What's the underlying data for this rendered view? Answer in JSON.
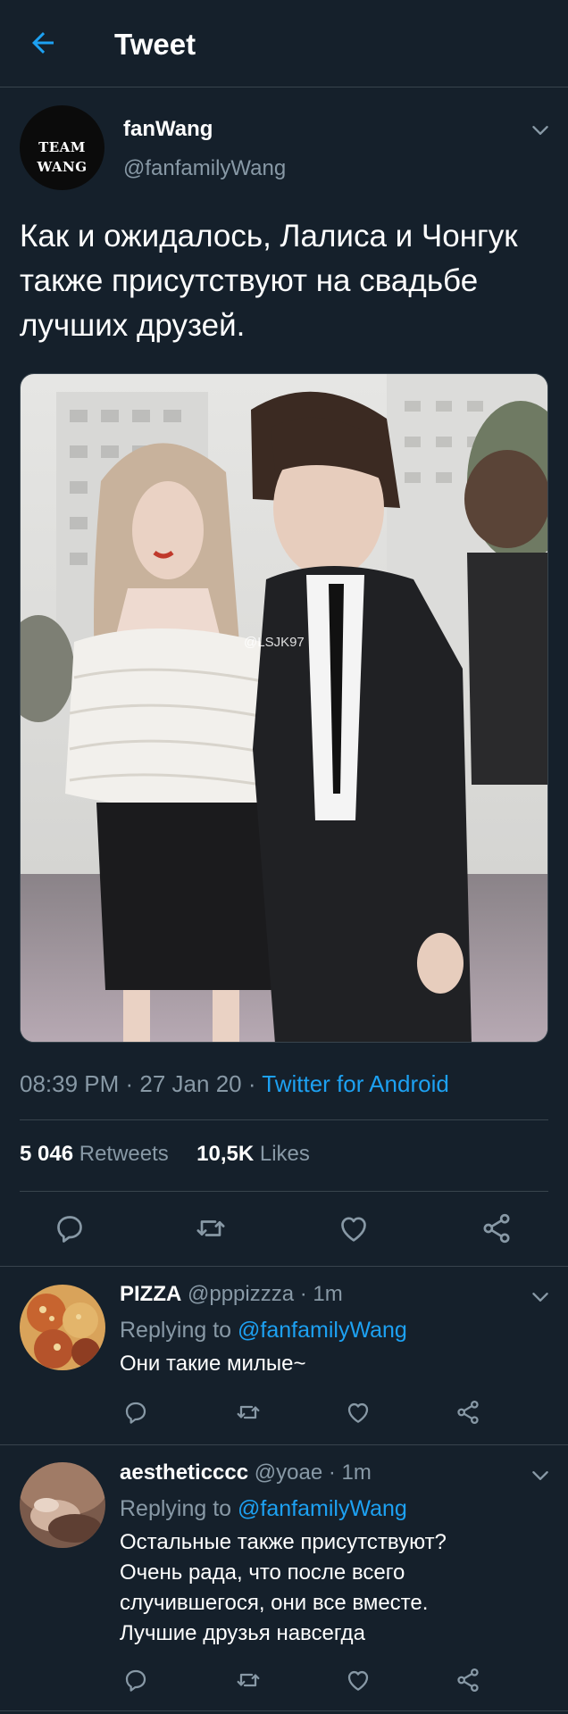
{
  "header": {
    "title": "Tweet",
    "back_icon": "arrow-left-icon",
    "accent_color": "#1da1f2"
  },
  "tweet": {
    "author": {
      "avatar_text": "TEAM WANG",
      "display_name": "fanWang",
      "handle": "@fanfamilyWang"
    },
    "text": "Как и ожидалось, Лалиса и Чонгук также присутствуют на свадьбе лучших друзей.",
    "image_watermark": "@LSJK97",
    "time": "08:39 PM",
    "date": "27 Jan 20",
    "source": "Twitter for Android",
    "separator": " · ",
    "retweets_count": "5 046",
    "retweets_label": "Retweets",
    "likes_count": "10,5K",
    "likes_label": "Likes",
    "actions": [
      "reply-icon",
      "retweet-icon",
      "like-icon",
      "share-icon"
    ]
  },
  "replies": [
    {
      "display_name": "PIZZA",
      "handle": "@pppizzza",
      "time": "1m",
      "replying_to_label": "Replying to",
      "replying_to_handle": "@fanfamilyWang",
      "text_lines": [
        "Они такие милые~"
      ]
    },
    {
      "display_name": "aestheticccc",
      "handle": "@yoae",
      "time": "1m",
      "replying_to_label": "Replying to",
      "replying_to_handle": "@fanfamilyWang",
      "text_lines": [
        "Остальные также присутствуют?",
        "Очень рада, что после всего",
        "случившегося, они все вместе.",
        "Лучшие друзья навсегда"
      ]
    }
  ],
  "colors": {
    "background": "#15202b",
    "divider": "#38444d",
    "muted_text": "#8899a6",
    "link": "#1da1f2"
  }
}
